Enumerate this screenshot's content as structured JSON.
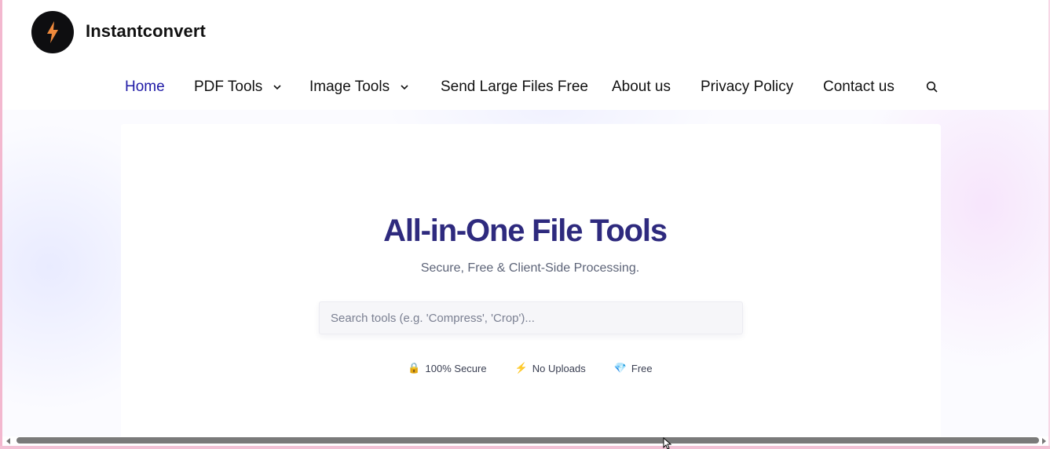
{
  "brand": {
    "name": "Instantconvert",
    "logo_icon": "lightning-bolt-icon",
    "logo_bg": "#0e0e10",
    "bolt_color": "#f08a3c"
  },
  "nav": {
    "items": [
      {
        "label": "Home",
        "active": true,
        "dropdown": false
      },
      {
        "label": "PDF Tools",
        "active": false,
        "dropdown": true
      },
      {
        "label": "Image Tools",
        "active": false,
        "dropdown": true
      },
      {
        "label": "Send Large Files Free",
        "active": false,
        "dropdown": false
      },
      {
        "label": "About us",
        "active": false,
        "dropdown": false
      },
      {
        "label": "Privacy Policy",
        "active": false,
        "dropdown": false
      },
      {
        "label": "Contact us",
        "active": false,
        "dropdown": false
      }
    ],
    "search_icon": "search-icon",
    "active_color": "#1f1aa6"
  },
  "hero": {
    "title": "All-in-One File Tools",
    "subtitle": "Secure, Free & Client-Side Processing.",
    "search_placeholder": "Search tools (e.g. 'Compress', 'Crop')...",
    "search_value": "",
    "title_color": "#2e2a7e",
    "badges": [
      {
        "icon": "🔒",
        "icon_name": "lock-icon",
        "label": "100% Secure"
      },
      {
        "icon": "⚡",
        "icon_name": "lightning-icon",
        "label": "No Uploads"
      },
      {
        "icon": "💎",
        "icon_name": "diamond-icon",
        "label": "Free"
      }
    ]
  }
}
